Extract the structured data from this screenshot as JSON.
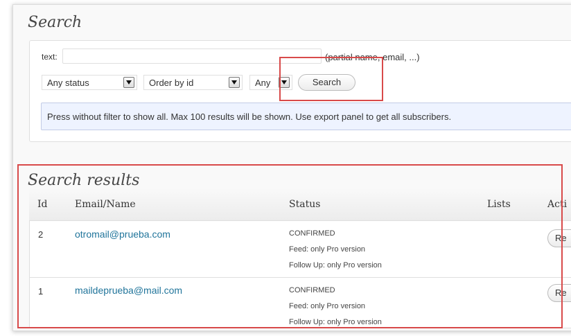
{
  "search": {
    "title": "Search",
    "text_label": "text:",
    "text_value": "",
    "hint": "(partial name, email, ...)",
    "status_select": "Any status",
    "order_select": "Order by id",
    "list_select": "Any",
    "search_button": "Search",
    "notice": "Press without filter to show all. Max 100 results will be shown. Use export panel to get all subscribers."
  },
  "results": {
    "title": "Search results",
    "columns": [
      "Id",
      "Email/Name",
      "Status",
      "Lists",
      "Acti"
    ],
    "rows": [
      {
        "id": "2",
        "email": "otromail@prueba.com",
        "status": "CONFIRMED",
        "feed": "Feed: only Pro version",
        "followup": "Follow Up: only Pro version",
        "action": "Re"
      },
      {
        "id": "1",
        "email": "maildeprueba@mail.com",
        "status": "CONFIRMED",
        "feed": "Feed: only Pro version",
        "followup": "Follow Up: only Pro version",
        "action": "Re"
      }
    ]
  },
  "colors": {
    "highlight": "#d84a4a",
    "link": "#21759b",
    "notice_bg": "#eef3ff"
  }
}
